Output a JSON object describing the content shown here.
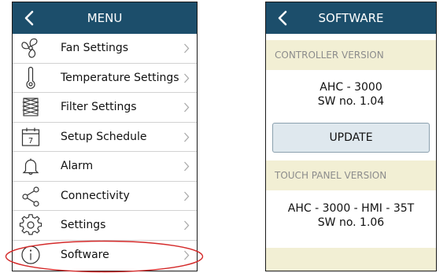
{
  "menu": {
    "title": "MENU",
    "items": [
      {
        "label": "Fan Settings",
        "icon": "fan-icon"
      },
      {
        "label": "Temperature Settings",
        "icon": "thermometer-icon"
      },
      {
        "label": "Filter Settings",
        "icon": "filter-icon"
      },
      {
        "label": "Setup Schedule",
        "icon": "calendar-icon"
      },
      {
        "label": "Alarm",
        "icon": "bell-icon"
      },
      {
        "label": "Connectivity",
        "icon": "share-icon"
      },
      {
        "label": "Settings",
        "icon": "gear-icon"
      },
      {
        "label": "Software",
        "icon": "info-icon"
      }
    ],
    "calendar_day": "7"
  },
  "software": {
    "title": "SOFTWARE",
    "controller_header": "CONTROLLER VERSION",
    "controller_model": "AHC - 3000",
    "controller_sw": "SW no. 1.04",
    "update_label": "UPDATE",
    "touch_header": "TOUCH PANEL VERSION",
    "touch_model": "AHC - 3000 - HMI - 35T",
    "touch_sw": "SW no. 1.06"
  },
  "colors": {
    "titlebar": "#1c4e6b",
    "section_bg": "#f2efd4",
    "highlight": "#d42a2a"
  }
}
